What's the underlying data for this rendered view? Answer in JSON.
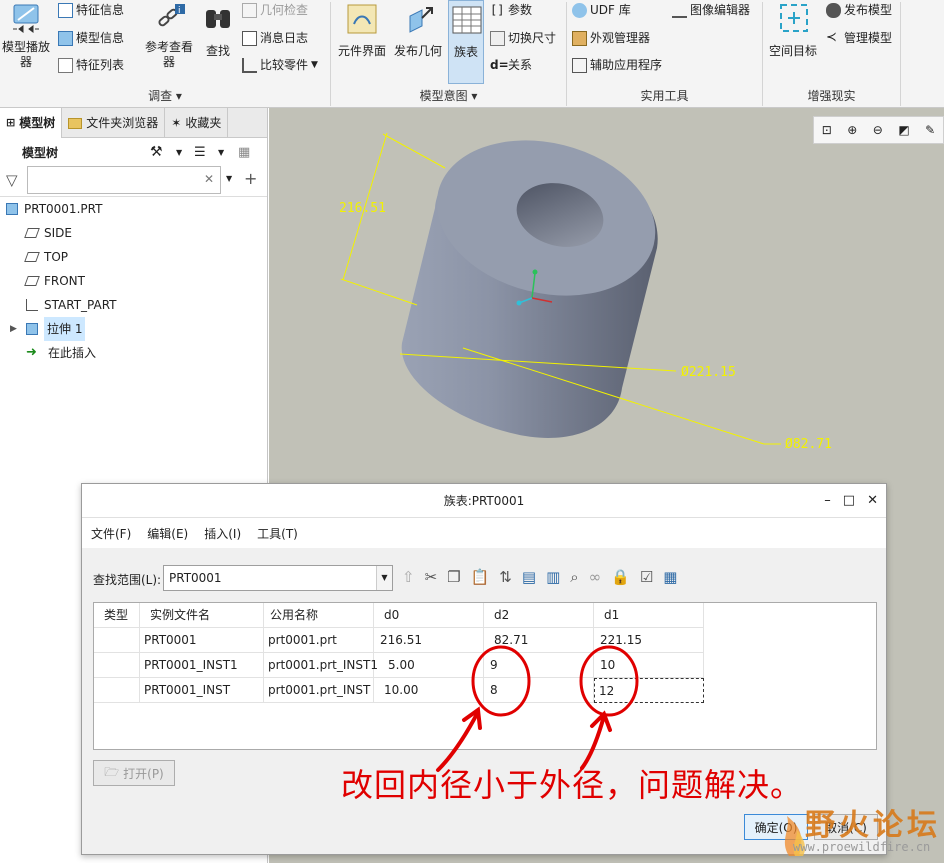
{
  "ribbon": {
    "model_play": "模型播放器",
    "feature_info": "特征信息",
    "model_info": "模型信息",
    "feature_list": "特征列表",
    "ref_viewer": "参考查看器",
    "find": "查找",
    "geom_check": "几何检查",
    "msg_log": "消息日志",
    "compare_parts": "比较零件",
    "component_ui": "元件界面",
    "publish_geom": "发布几何",
    "family_table": "族表",
    "params": "参数",
    "switch_dims": "切换尺寸",
    "relations": "关系",
    "udf_lib": "UDF 库",
    "appearance_mgr": "外观管理器",
    "aux_apps": "辅助应用程序",
    "image_editor": "图像编辑器",
    "spatial_target": "空间目标",
    "publish_model": "发布模型",
    "manage_model": "管理模型",
    "groups": {
      "investigate": "调查",
      "model_intent": "模型意图",
      "utilities": "实用工具",
      "ar": "增强现实"
    }
  },
  "left_panel": {
    "tabs": [
      "模型树",
      "文件夹浏览器",
      "收藏夹"
    ],
    "tree_title": "模型树",
    "filter_placeholder": "",
    "items": [
      "PRT0001.PRT",
      "SIDE",
      "TOP",
      "FRONT",
      "START_PART",
      "拉伸 1",
      "在此插入"
    ]
  },
  "graphics": {
    "dim_height": "216.51",
    "dim_outer": "Ø221.15",
    "dim_inner": "Ø82.71"
  },
  "dialog": {
    "title": "族表:PRT0001",
    "menus": [
      "文件(F)",
      "编辑(E)",
      "插入(I)",
      "工具(T)"
    ],
    "scope_label": "查找范围(L):",
    "scope_value": "PRT0001",
    "headers": [
      "类型",
      "实例文件名",
      "公用名称",
      "d0",
      "d2",
      "d1"
    ],
    "rows": [
      [
        "",
        "PRT0001",
        "prt0001.prt",
        "216.51",
        "82.71",
        "221.15"
      ],
      [
        "",
        "PRT0001_INST1",
        "prt0001.prt_INST1",
        "5.00",
        "9",
        "10"
      ],
      [
        "",
        "PRT0001_INST",
        "prt0001.prt_INST",
        "10.00",
        "8",
        "12"
      ]
    ],
    "open_button": "打开(P)",
    "ok_button": "确定(O)",
    "cancel_button": "取消(C)"
  },
  "annotation": "改回内径小于外径，问题解决。",
  "watermark": {
    "name": "野火论坛",
    "url": "www.proewildfire.cn"
  },
  "colors": {
    "annotation_red": "#e00000",
    "dimension_yellow": "#f2f200",
    "selection_blue": "#cde8ff",
    "arrow_green": "#1b8a1b"
  }
}
